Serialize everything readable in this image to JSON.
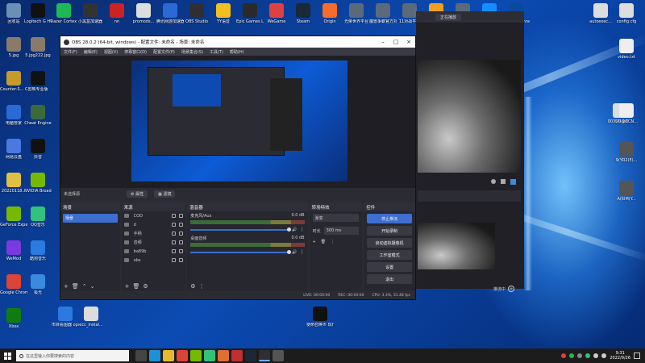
{
  "desktop": {
    "icons_left": [
      {
        "label": "回收站",
        "color": "#6b8fb5"
      },
      {
        "label": "5.jpg",
        "color": "#8a7a6a"
      },
      {
        "label": "Counter-S... Global Off...",
        "color": "#c69b2a"
      },
      {
        "label": "电脑管家",
        "color": "#2a6ad6"
      },
      {
        "label": "网易云盘",
        "color": "#4a7ae0"
      },
      {
        "label": "20220118...",
        "color": "#e0c040"
      },
      {
        "label": "GeForce Experience",
        "color": "#76b900"
      },
      {
        "label": "WeMod",
        "color": "#7a3ae0"
      },
      {
        "label": "Google Chrome",
        "color": "#db4437"
      },
      {
        "label": "Xbox",
        "color": "#107c10"
      }
    ],
    "icons_col2": [
      {
        "label": "Logitech G HUB",
        "color": "#111111"
      },
      {
        "label": "5.jpg222.jpg",
        "color": "#8a7a6a"
      },
      {
        "label": "剪映专业版",
        "color": "#111111"
      },
      {
        "label": "Cheat Engine",
        "color": "#3a6a3a"
      },
      {
        "label": "抖音",
        "color": "#111111"
      },
      {
        "label": "NVIDIA Broadcast",
        "color": "#76b900"
      },
      {
        "label": "QQ音乐",
        "color": "#31c27c"
      },
      {
        "label": "酷狗音乐",
        "color": "#2a7ae0"
      },
      {
        "label": "极光",
        "color": "#3a8ae0"
      }
    ],
    "icons_top": [
      {
        "label": "Razer Cortex",
        "color": "#1db954"
      },
      {
        "label": "小黑盒加速器",
        "color": "#333333"
      },
      {
        "label": "nn",
        "color": "#cc2222"
      },
      {
        "label": "promods...",
        "color": "#dddddd"
      },
      {
        "label": "腾讯网游加速器",
        "color": "#2a6ad6"
      },
      {
        "label": "OBS Studio",
        "color": "#302e31"
      },
      {
        "label": "YY语音",
        "color": "#f0c020"
      },
      {
        "label": "Epic Games Launcher",
        "color": "#2a2a2a"
      },
      {
        "label": "WeGame",
        "color": "#e04040"
      },
      {
        "label": "Steam",
        "color": "#1b2838"
      },
      {
        "label": "Origin",
        "color": "#f56c2d"
      },
      {
        "label": "光荣世界平台",
        "color": "#5a6a7a"
      },
      {
        "label": "魔兽争霸官方对战平台",
        "color": "#5a6a7a"
      },
      {
        "label": "11对战平台",
        "color": "#5a6a7a"
      },
      {
        "label": "Rockstar Games...",
        "color": "#f0a020"
      },
      {
        "label": "网易游戏平台",
        "color": "#5a6a7a"
      },
      {
        "label": "暴雪战网",
        "color": "#148eff"
      },
      {
        "label": "Ubisoft Connect",
        "color": "#0a4a9a"
      }
    ],
    "icons_right": [
      {
        "label": "autoexec...",
        "color": "#dddddd"
      },
      {
        "label": "config.cfg",
        "color": "#dddddd"
      },
      {
        "label": "video.txt",
        "color": "#eeeeee"
      },
      {
        "label": "00310-9/8...",
        "color": "#dddddd"
      },
      {
        "label": "UU@CCN...",
        "color": "#eeeeee"
      },
      {
        "label": "9(YR2(E)...",
        "color": "#555555"
      },
      {
        "label": "A(6IM(Y...",
        "color": "#555555"
      }
    ],
    "icons_bottom": [
      {
        "label": "市目看图器 opc-li880...",
        "color": "#2a7ae0"
      },
      {
        "label": "ecc_instal...",
        "color": "#dddddd"
      },
      {
        "label": "使命召唤® 现代战争...",
        "color": "#111111"
      }
    ]
  },
  "obs": {
    "title": "OBS 28.0.2 (64-bit, windows) - 配置文件: 未命名 - 场景: 未命名",
    "menu": [
      "文件(F)",
      "编辑(E)",
      "视图(V)",
      "停靠窗口(D)",
      "配置文件(P)",
      "场景集合(S)",
      "工具(T)",
      "帮助(H)"
    ],
    "no_scene_text": "未选择源",
    "properties_label": "属性",
    "filters_label": "滤镜",
    "docks": {
      "scenes": {
        "title": "场景",
        "items": [
          "场景"
        ]
      },
      "sources": {
        "title": "来源",
        "items": [
          "COD",
          "d",
          "手柄",
          "音频",
          "ba89b",
          "obs"
        ]
      },
      "mixer": {
        "title": "混音器",
        "channels": [
          {
            "name": "麦克风/Aux",
            "db": "0.0 dB"
          },
          {
            "name": "桌面音频",
            "db": "0.0 dB"
          }
        ]
      },
      "transitions": {
        "title": "转场特效",
        "type": "渐变",
        "duration_label": "时长",
        "duration": "300 ms"
      },
      "controls": {
        "title": "控件",
        "buttons": [
          "停止推流",
          "开始录制",
          "启动虚拟摄像机",
          "工作室模式",
          "设置",
          "退出"
        ]
      }
    },
    "status": {
      "live": "LIVE: 00:00:00",
      "rec": "REC: 00:00:00",
      "cpu": "CPU: 3.3%, 31.48 fps"
    }
  },
  "bgwin": {
    "tab_label": "正在播放",
    "footer_label": "推流中"
  },
  "taskbar": {
    "search_placeholder": "在这里输入你要搜索的内容",
    "time": "9:31",
    "date": "2022/9/26"
  }
}
